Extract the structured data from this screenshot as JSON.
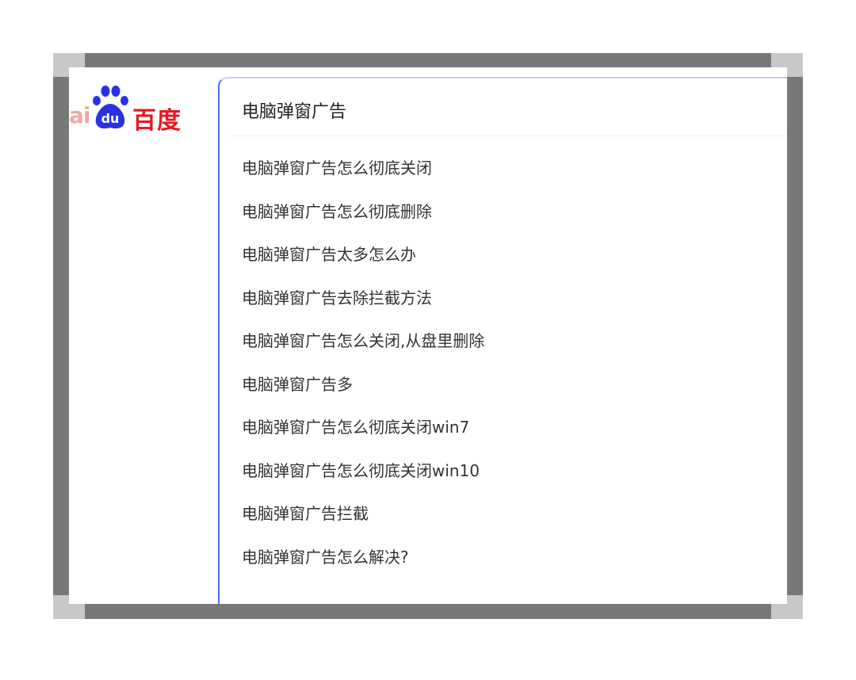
{
  "logo": {
    "prefix": "ai",
    "paw_text": "du",
    "chinese": "百度",
    "brand_red": "#e31b23",
    "brand_blue": "#2932e1"
  },
  "search": {
    "query": "电脑弹窗广告",
    "accent": "#4e6ef2"
  },
  "suggestions": [
    "电脑弹窗广告怎么彻底关闭",
    "电脑弹窗广告怎么彻底删除",
    "电脑弹窗广告太多怎么办",
    "电脑弹窗广告去除拦截方法",
    "电脑弹窗广告怎么关闭,从盘里删除",
    "电脑弹窗广告多",
    "电脑弹窗广告怎么彻底关闭win7",
    "电脑弹窗广告怎么彻底关闭win10",
    "电脑弹窗广告拦截",
    "电脑弹窗广告怎么解决?"
  ]
}
